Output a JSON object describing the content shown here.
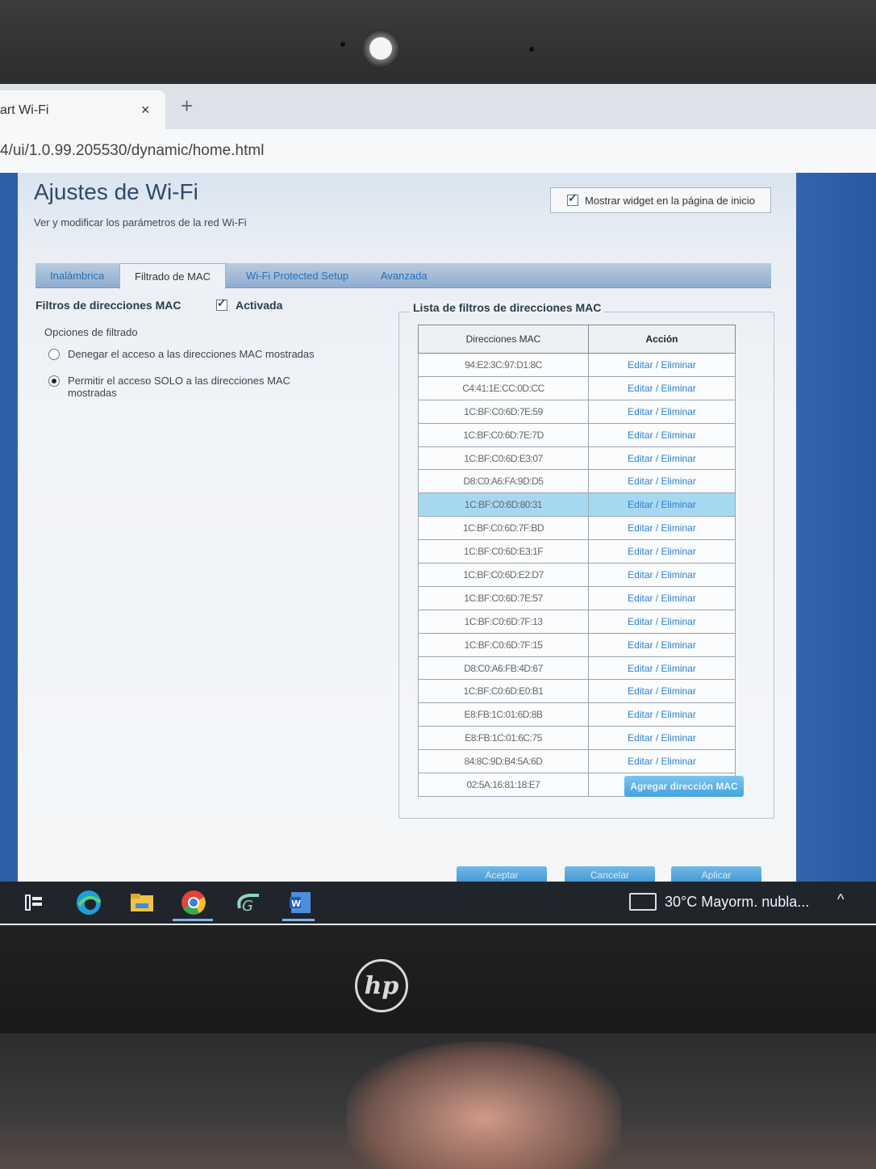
{
  "browser": {
    "tab_title": "art Wi-Fi",
    "tab_close": "×",
    "new_tab": "+",
    "url": "4/ui/1.0.99.205530/dynamic/home.html"
  },
  "page": {
    "title": "Ajustes de Wi-Fi",
    "subtitle": "Ver y modificar los parámetros de la red Wi-Fi",
    "widget_label": "Mostrar widget en la página de inicio",
    "widget_checked": true
  },
  "tabs": [
    {
      "label": "Inalámbrica",
      "active": false
    },
    {
      "label": "Filtrado de MAC",
      "active": true
    },
    {
      "label": "Wi-Fi Protected Setup",
      "active": false
    },
    {
      "label": "Avanzada",
      "active": false
    }
  ],
  "mac_filter": {
    "section_title": "Filtros de direcciones MAC",
    "enabled_label": "Activada",
    "enabled": true,
    "options_label": "Opciones de filtrado",
    "option_deny": "Denegar el acceso a las direcciones MAC mostradas",
    "option_allow": "Permitir el acceso SOLO a las direcciones MAC mostradas",
    "selected_option": "allow"
  },
  "mac_list": {
    "legend": "Lista de filtros de direcciones MAC",
    "col_mac": "Direcciones MAC",
    "col_action": "Acción",
    "action_label": "Editar / Eliminar",
    "rows": [
      "94:E2:3C:97:D1:8C",
      "C4:41:1E:CC:0D:CC",
      "1C:BF:C0:6D:7E:59",
      "1C:BF:C0:6D:7E:7D",
      "1C:BF:C0:6D:E3:07",
      "D8:C0:A6:FA:9D:D5",
      "1C:BF:C0:6D:80:31",
      "1C:BF:C0:6D:7F:BD",
      "1C:BF:C0:6D:E3:1F",
      "1C:BF:C0:6D:E2:D7",
      "1C:BF:C0:6D:7E:57",
      "1C:BF:C0:6D:7F:13",
      "1C:BF:C0:6D:7F:15",
      "D8:C0:A6:FB:4D:67",
      "1C:BF:C0:6D:E0:B1",
      "E8:FB:1C:01:6D:8B",
      "E8:FB:1C:01:6C:75",
      "84:8C:9D:B4:5A:6D",
      "02:5A:16:81:18:E7"
    ],
    "selected_index": 6,
    "add_button": "Agregar dirección MAC"
  },
  "footer_buttons": {
    "accept": "Aceptar",
    "cancel": "Cancelar",
    "apply": "Aplicar"
  },
  "taskbar": {
    "weather": "30°C  Mayorm. nubla...",
    "apps": [
      "task-view-icon",
      "edge-icon",
      "file-explorer-icon",
      "chrome-icon",
      "app-g-icon",
      "word-icon"
    ]
  },
  "colors": {
    "link": "#2b7fd0",
    "selected_row": "#a7d8f2",
    "button": "#42a3df",
    "page_bg": "#3e72bb"
  },
  "hardware": {
    "logo": "hp"
  }
}
